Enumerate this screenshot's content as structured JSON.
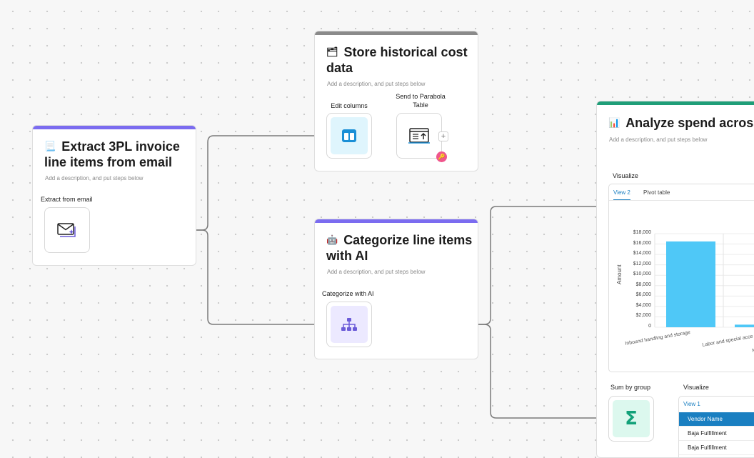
{
  "cards": {
    "extract": {
      "emoji": "📃",
      "title_line1": "Extract 3PL invoice",
      "title_line2": "line items from email",
      "description": "Add a description, and put steps below",
      "accent": "#7b6cf0",
      "step_label": "Extract from email"
    },
    "store": {
      "emoji": "🗂",
      "title_line1": "Store historical cost",
      "title_line2": "data",
      "description": "Add a description, and put steps below",
      "accent": "#8a8a8a",
      "step1_label": "Edit columns",
      "step2_label_line1": "Send to Parabola",
      "step2_label_line2": "Table",
      "plus": "+"
    },
    "categorize": {
      "emoji": "🤖",
      "title_line1": "Categorize line items",
      "title_line2": "with AI",
      "description": "Add a description, and put steps below",
      "accent": "#7b6cf0",
      "step_label": "Categorize with AI"
    },
    "analyze": {
      "emoji": "📊",
      "title": "Analyze spend across c",
      "description": "Add a description, and put steps below",
      "accent": "#1f9e78",
      "visualize_label": "Visualize",
      "tabs": [
        "View 2",
        "Pivot table"
      ],
      "sum_label": "Sum by group",
      "visualize2_label": "Visualize",
      "table_tab": "View 1",
      "table_header": "Vendor Name",
      "table_rows": [
        "Baja Fulfillment",
        "Baja Fulfillment"
      ]
    }
  },
  "chart_data": {
    "type": "bar",
    "ylabel": "Amount",
    "ylim": [
      0,
      18000
    ],
    "y_ticks": [
      "$18,000",
      "$16,000",
      "$14,000",
      "$12,000",
      "$10,000",
      "$8,000",
      "$6,000",
      "$4,000",
      "$2,000",
      "0"
    ],
    "categories": [
      "Inbound handling and storage",
      "Labor and special acce",
      "Miscella"
    ],
    "values": [
      16500,
      500,
      0
    ],
    "bar_color": "#4fc8f7"
  }
}
